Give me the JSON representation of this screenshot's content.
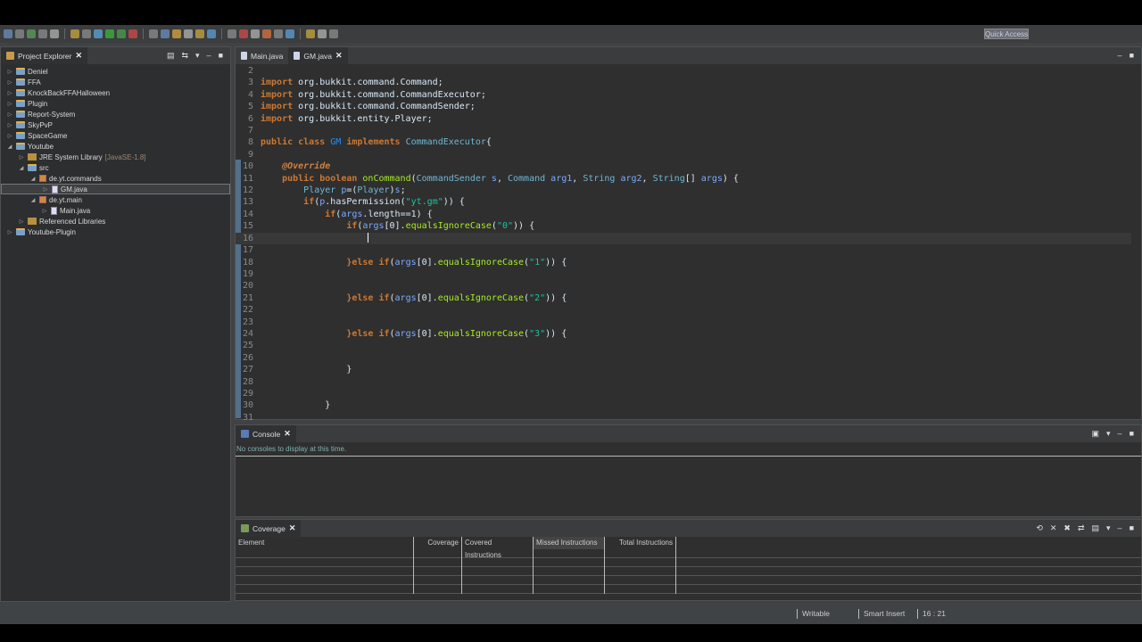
{
  "toolbar": {
    "quick_access": "Quick Access"
  },
  "project_explorer": {
    "title": "Project Explorer",
    "items": [
      {
        "label": "Deniel",
        "level": 0,
        "kind": "project",
        "state": "collapsed"
      },
      {
        "label": "FFA",
        "level": 0,
        "kind": "project",
        "state": "collapsed"
      },
      {
        "label": "KnockBackFFAHalloween",
        "level": 0,
        "kind": "project",
        "state": "collapsed"
      },
      {
        "label": "Plugin",
        "level": 0,
        "kind": "project",
        "state": "collapsed"
      },
      {
        "label": "Report-System",
        "level": 0,
        "kind": "project",
        "state": "collapsed"
      },
      {
        "label": "SkyPvP",
        "level": 0,
        "kind": "project",
        "state": "collapsed"
      },
      {
        "label": "SpaceGame",
        "level": 0,
        "kind": "project",
        "state": "collapsed"
      },
      {
        "label": "Youtube",
        "level": 0,
        "kind": "project",
        "state": "expanded"
      },
      {
        "label": "JRE System Library",
        "suffix": "[JavaSE-1.8]",
        "level": 1,
        "kind": "lib",
        "state": "collapsed"
      },
      {
        "label": "src",
        "level": 1,
        "kind": "folder",
        "state": "expanded"
      },
      {
        "label": "de.yt.commands",
        "level": 2,
        "kind": "pkg",
        "state": "expanded"
      },
      {
        "label": "GM.java",
        "level": 3,
        "kind": "java",
        "state": "collapsed",
        "selected": true
      },
      {
        "label": "de.yt.main",
        "level": 2,
        "kind": "pkg",
        "state": "expanded"
      },
      {
        "label": "Main.java",
        "level": 3,
        "kind": "java",
        "state": "collapsed"
      },
      {
        "label": "Referenced Libraries",
        "level": 1,
        "kind": "lib",
        "state": "collapsed"
      },
      {
        "label": "Youtube-Plugin",
        "level": 0,
        "kind": "project",
        "state": "collapsed"
      }
    ]
  },
  "editor": {
    "tabs": [
      {
        "label": "Main.java",
        "active": false
      },
      {
        "label": "GM.java",
        "active": true
      }
    ],
    "cursor_line": 16,
    "lines": [
      {
        "n": "2",
        "tokens": []
      },
      {
        "n": "3",
        "tokens": [
          [
            "import",
            "k"
          ],
          [
            " org.bukkit.command.Command;",
            "p"
          ]
        ]
      },
      {
        "n": "4",
        "tokens": [
          [
            "import",
            "k"
          ],
          [
            " org.bukkit.command.CommandExecutor;",
            "p"
          ]
        ]
      },
      {
        "n": "5",
        "tokens": [
          [
            "import",
            "k"
          ],
          [
            " org.bukkit.command.CommandSender;",
            "p"
          ]
        ]
      },
      {
        "n": "6",
        "tokens": [
          [
            "import",
            "k"
          ],
          [
            " org.bukkit.entity.Player;",
            "p"
          ]
        ]
      },
      {
        "n": "7",
        "tokens": []
      },
      {
        "n": "8",
        "tokens": [
          [
            "public class ",
            "k"
          ],
          [
            "GM",
            "c"
          ],
          [
            " implements ",
            "k"
          ],
          [
            "CommandExecutor",
            "t"
          ],
          [
            "{",
            "p"
          ]
        ]
      },
      {
        "n": "9",
        "tokens": []
      },
      {
        "n": "10",
        "tokens": [
          [
            "    ",
            "p"
          ],
          [
            "@Override",
            "a"
          ]
        ]
      },
      {
        "n": "11",
        "tokens": [
          [
            "    ",
            "p"
          ],
          [
            "public boolean ",
            "k"
          ],
          [
            "onCommand",
            "m"
          ],
          [
            "(",
            "p"
          ],
          [
            "CommandSender",
            "t"
          ],
          [
            " s",
            "v"
          ],
          [
            ", ",
            "p"
          ],
          [
            "Command",
            "t"
          ],
          [
            " arg1",
            "v"
          ],
          [
            ", ",
            "p"
          ],
          [
            "String",
            "t"
          ],
          [
            " arg2",
            "v"
          ],
          [
            ", ",
            "p"
          ],
          [
            "String",
            "t"
          ],
          [
            "[] ",
            "p"
          ],
          [
            "args",
            "v"
          ],
          [
            ") {",
            "p"
          ]
        ]
      },
      {
        "n": "12",
        "tokens": [
          [
            "        ",
            "p"
          ],
          [
            "Player",
            "t"
          ],
          [
            " p",
            "v"
          ],
          [
            "=(",
            "p"
          ],
          [
            "Player",
            "t"
          ],
          [
            ")",
            "p"
          ],
          [
            "s",
            "v"
          ],
          [
            ";",
            "p"
          ]
        ]
      },
      {
        "n": "13",
        "tokens": [
          [
            "        ",
            "p"
          ],
          [
            "if",
            "k"
          ],
          [
            "(",
            "p"
          ],
          [
            "p",
            "v"
          ],
          [
            ".hasPermission(",
            "p"
          ],
          [
            "\"yt.gm\"",
            "s"
          ],
          [
            ")) {",
            "p"
          ]
        ]
      },
      {
        "n": "14",
        "tokens": [
          [
            "            ",
            "p"
          ],
          [
            "if",
            "k"
          ],
          [
            "(",
            "p"
          ],
          [
            "args",
            "v"
          ],
          [
            ".length==1) {",
            "p"
          ]
        ]
      },
      {
        "n": "15",
        "tokens": [
          [
            "                ",
            "p"
          ],
          [
            "if",
            "k"
          ],
          [
            "(",
            "p"
          ],
          [
            "args",
            "v"
          ],
          [
            "[0].",
            "p"
          ],
          [
            "equalsIgnoreCase",
            "m"
          ],
          [
            "(",
            "p"
          ],
          [
            "\"0\"",
            "s"
          ],
          [
            ")) {",
            "p"
          ]
        ]
      },
      {
        "n": "16",
        "tokens": [
          [
            "                    ",
            "p"
          ]
        ]
      },
      {
        "n": "17",
        "tokens": []
      },
      {
        "n": "18",
        "tokens": [
          [
            "                ",
            "p"
          ],
          [
            "}else if",
            "k"
          ],
          [
            "(",
            "p"
          ],
          [
            "args",
            "v"
          ],
          [
            "[0].",
            "p"
          ],
          [
            "equalsIgnoreCase",
            "m"
          ],
          [
            "(",
            "p"
          ],
          [
            "\"1\"",
            "s"
          ],
          [
            ")) {",
            "p"
          ]
        ]
      },
      {
        "n": "19",
        "tokens": []
      },
      {
        "n": "20",
        "tokens": []
      },
      {
        "n": "21",
        "tokens": [
          [
            "                ",
            "p"
          ],
          [
            "}else if",
            "k"
          ],
          [
            "(",
            "p"
          ],
          [
            "args",
            "v"
          ],
          [
            "[0].",
            "p"
          ],
          [
            "equalsIgnoreCase",
            "m"
          ],
          [
            "(",
            "p"
          ],
          [
            "\"2\"",
            "s"
          ],
          [
            ")) {",
            "p"
          ]
        ]
      },
      {
        "n": "22",
        "tokens": []
      },
      {
        "n": "23",
        "tokens": []
      },
      {
        "n": "24",
        "tokens": [
          [
            "                ",
            "p"
          ],
          [
            "}else if",
            "k"
          ],
          [
            "(",
            "p"
          ],
          [
            "args",
            "v"
          ],
          [
            "[0].",
            "p"
          ],
          [
            "equalsIgnoreCase",
            "m"
          ],
          [
            "(",
            "p"
          ],
          [
            "\"3\"",
            "s"
          ],
          [
            ")) {",
            "p"
          ]
        ]
      },
      {
        "n": "25",
        "tokens": []
      },
      {
        "n": "26",
        "tokens": []
      },
      {
        "n": "27",
        "tokens": [
          [
            "                ",
            "p"
          ],
          [
            "}",
            "p"
          ]
        ]
      },
      {
        "n": "28",
        "tokens": []
      },
      {
        "n": "29",
        "tokens": []
      },
      {
        "n": "30",
        "tokens": [
          [
            "            ",
            "p"
          ],
          [
            "}",
            "p"
          ]
        ]
      },
      {
        "n": "31",
        "tokens": []
      }
    ]
  },
  "console": {
    "title": "Console",
    "message": "No consoles to display at this time."
  },
  "coverage": {
    "title": "Coverage",
    "columns": [
      "Element",
      "Coverage",
      "Covered Instructions",
      "Missed Instructions",
      "Total Instructions"
    ]
  },
  "status": {
    "writable": "Writable",
    "insert_mode": "Smart Insert",
    "position": "16 : 21"
  }
}
